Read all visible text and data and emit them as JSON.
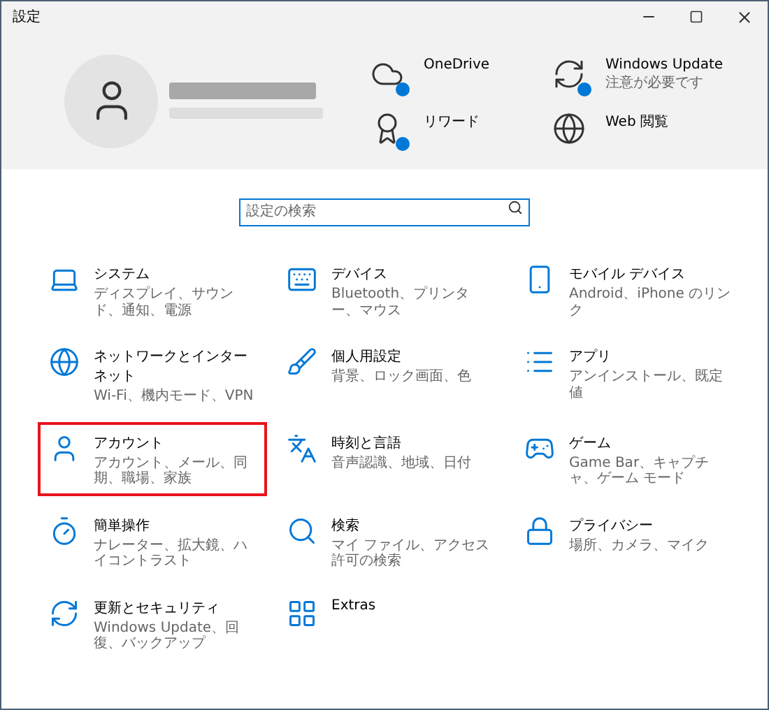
{
  "window": {
    "title": "設定"
  },
  "quick_links": [
    {
      "label": "OneDrive",
      "badge": true
    },
    {
      "label": "Windows Update",
      "status": "注意が必要です",
      "badge": true
    },
    {
      "label": "リワード",
      "badge": true
    },
    {
      "label": "Web 閲覧",
      "badge": false
    }
  ],
  "search": {
    "placeholder": "設定の検索"
  },
  "categories": [
    {
      "title": "システム",
      "description": "ディスプレイ、サウンド、通知、電源",
      "highlighted": false
    },
    {
      "title": "デバイス",
      "description": "Bluetooth、プリンター、マウス",
      "highlighted": false
    },
    {
      "title": "モバイル デバイス",
      "description": "Android、iPhone のリンク",
      "highlighted": false
    },
    {
      "title": "ネットワークとインターネット",
      "description": "Wi-Fi、機内モード、VPN",
      "highlighted": false
    },
    {
      "title": "個人用設定",
      "description": "背景、ロック画面、色",
      "highlighted": false
    },
    {
      "title": "アプリ",
      "description": "アンインストール、既定値",
      "highlighted": false
    },
    {
      "title": "アカウント",
      "description": "アカウント、メール、同期、職場、家族",
      "highlighted": true
    },
    {
      "title": "時刻と言語",
      "description": "音声認識、地域、日付",
      "highlighted": false
    },
    {
      "title": "ゲーム",
      "description": "Game Bar、キャプチャ、ゲーム モード",
      "highlighted": false
    },
    {
      "title": "簡単操作",
      "description": "ナレーター、拡大鏡、ハイコントラスト",
      "highlighted": false
    },
    {
      "title": "検索",
      "description": "マイ ファイル、アクセス許可の検索",
      "highlighted": false
    },
    {
      "title": "プライバシー",
      "description": "場所、カメラ、マイク",
      "highlighted": false
    },
    {
      "title": "更新とセキュリティ",
      "description": "Windows Update、回復、バックアップ",
      "highlighted": false
    },
    {
      "title": "Extras",
      "highlighted": false
    }
  ]
}
